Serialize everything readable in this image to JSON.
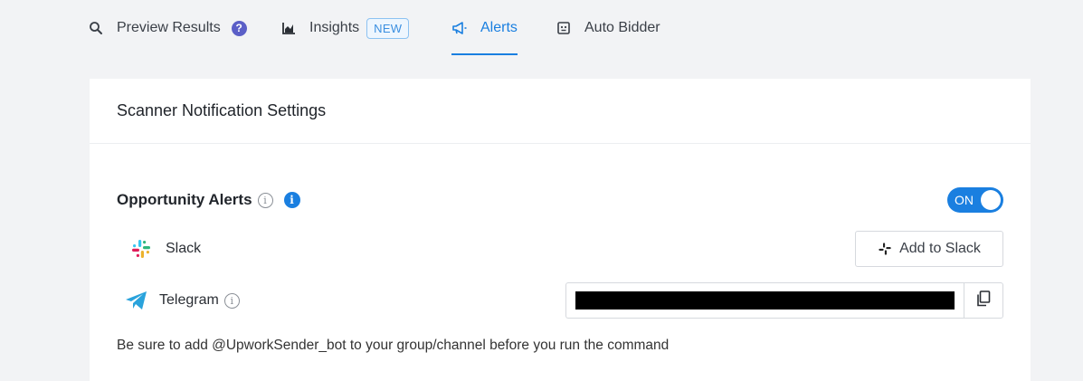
{
  "tabs": {
    "preview": {
      "label": "Preview Results",
      "icon": "search-icon",
      "help": "?"
    },
    "insights": {
      "label": "Insights",
      "icon": "bar-chart-icon",
      "badge": "NEW"
    },
    "alerts": {
      "label": "Alerts",
      "icon": "megaphone-icon",
      "active": true
    },
    "autobidder": {
      "label": "Auto Bidder",
      "icon": "robot-icon"
    }
  },
  "card": {
    "title": "Scanner Notification Settings",
    "alerts": {
      "title": "Opportunity Alerts",
      "info_outline": "i",
      "info_filled": "i",
      "toggle": {
        "label": "ON",
        "checked": true
      }
    },
    "slack": {
      "label": "Slack",
      "icon": "slack-icon",
      "button_label": "Add to Slack",
      "button_icon": "slack-mono-icon"
    },
    "telegram": {
      "label": "Telegram",
      "icon": "telegram-icon",
      "info": "i",
      "command_value": "",
      "copy_icon": "copy-icon"
    },
    "note": "Be sure to add @UpworkSender_bot to your group/channel before you run the command"
  },
  "colors": {
    "accent": "#1a7fe0",
    "help_badge": "#5b5fc7",
    "background": "#f2f3f5",
    "card": "#ffffff"
  }
}
